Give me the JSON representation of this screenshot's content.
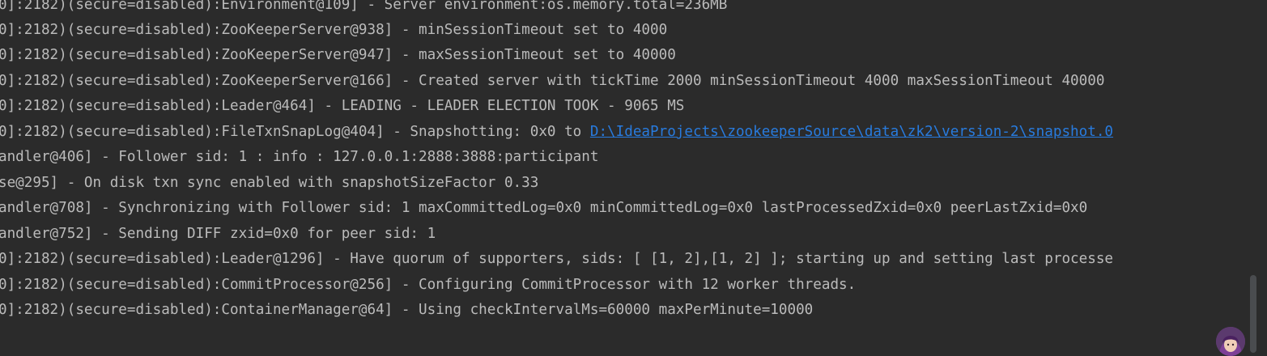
{
  "console": {
    "lines": [
      {
        "text": "0]:2182)(secure=disabled):Environment@109] - Server environment:os.memory.total=236MB"
      },
      {
        "text": "0]:2182)(secure=disabled):ZooKeeperServer@938] - minSessionTimeout set to 4000"
      },
      {
        "text": "0]:2182)(secure=disabled):ZooKeeperServer@947] - maxSessionTimeout set to 40000"
      },
      {
        "text": "0]:2182)(secure=disabled):ZooKeeperServer@166] - Created server with tickTime 2000 minSessionTimeout 4000 maxSessionTimeout 40000"
      },
      {
        "text": "0]:2182)(secure=disabled):Leader@464] - LEADING - LEADER ELECTION TOOK - 9065 MS"
      },
      {
        "text": "0]:2182)(secure=disabled):FileTxnSnapLog@404] - Snapshotting: 0x0 to ",
        "link": "D:\\IdeaProjects\\zookeeperSource\\data\\zk2\\version-2\\snapshot.0"
      },
      {
        "text": "andler@406] - Follower sid: 1 : info : 127.0.0.1:2888:3888:participant"
      },
      {
        "text": "se@295] - On disk txn sync enabled with snapshotSizeFactor 0.33"
      },
      {
        "text": "andler@708] - Synchronizing with Follower sid: 1 maxCommittedLog=0x0 minCommittedLog=0x0 lastProcessedZxid=0x0 peerLastZxid=0x0"
      },
      {
        "text": "andler@752] - Sending DIFF zxid=0x0 for peer sid: 1"
      },
      {
        "text": "0]:2182)(secure=disabled):Leader@1296] - Have quorum of supporters, sids: [ [1, 2],[1, 2] ]; starting up and setting last processe"
      },
      {
        "text": "0]:2182)(secure=disabled):CommitProcessor@256] - Configuring CommitProcessor with 12 worker threads."
      },
      {
        "text": "0]:2182)(secure=disabled):ContainerManager@64] - Using checkIntervalMs=60000 maxPerMinute=10000"
      }
    ]
  },
  "colors": {
    "background": "#2b2b2b",
    "text": "#bbbbbb",
    "link": "#287bde",
    "scrollbar_thumb": "#4a4c4f"
  }
}
